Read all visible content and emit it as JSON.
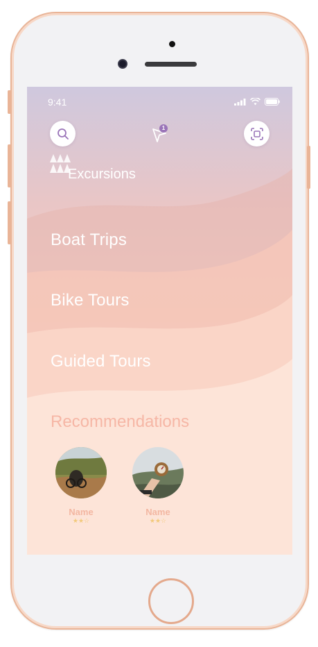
{
  "status_bar": {
    "time": "9:41"
  },
  "header": {
    "search_icon": "search-icon",
    "location_icon": "location-arrow-icon",
    "location_badge": "1",
    "scan_icon": "scan-icon",
    "title": "Excursions",
    "logo_icon": "trees-icon"
  },
  "categories": [
    {
      "label": "Boat Trips"
    },
    {
      "label": "Bike Tours"
    },
    {
      "label": "Guided Tours"
    }
  ],
  "recommendations": {
    "title": "Recommendations",
    "items": [
      {
        "name": "Name",
        "stars": "★★☆",
        "rating": 2,
        "max_rating": 3
      },
      {
        "name": "Name",
        "stars": "★★☆",
        "rating": 2,
        "max_rating": 3
      }
    ]
  },
  "colors": {
    "accent": "#9a74b8",
    "title_peach": "#f6b6a5",
    "star": "#f2c97a"
  }
}
